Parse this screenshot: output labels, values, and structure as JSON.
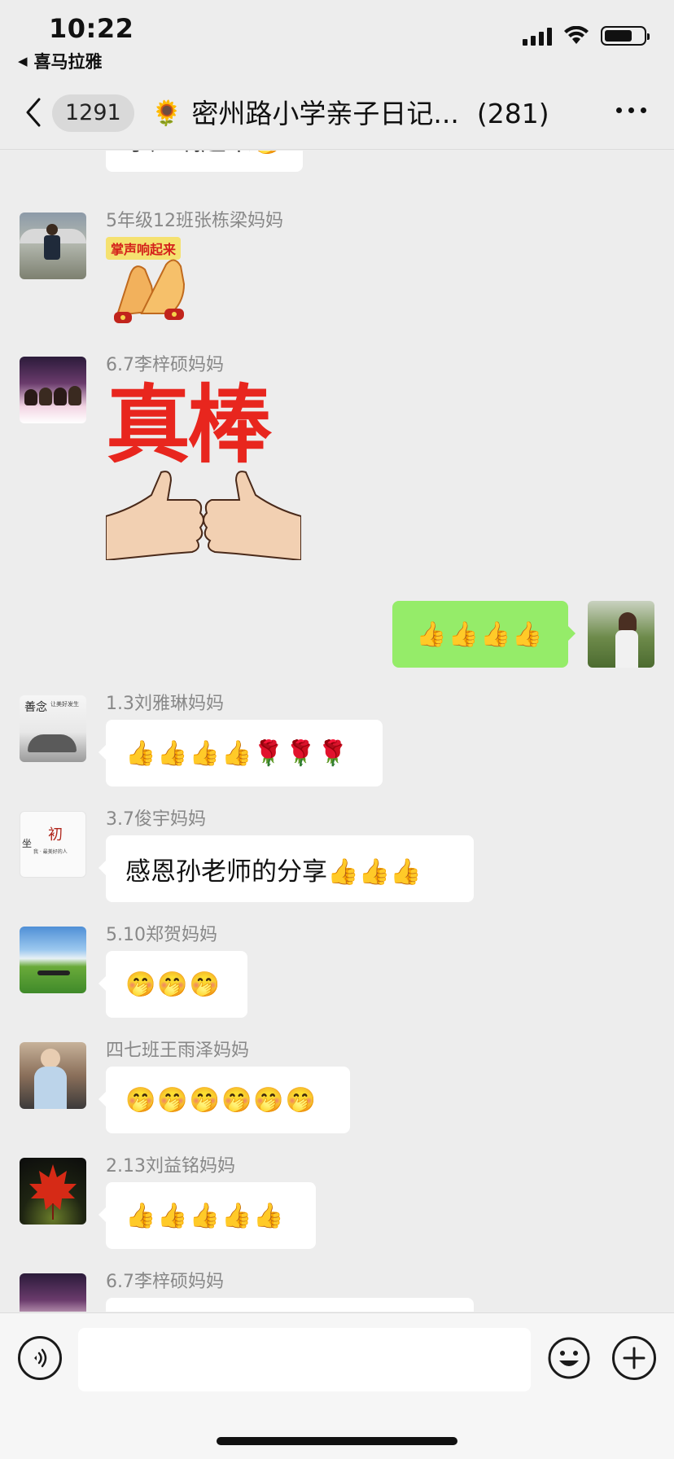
{
  "status": {
    "time": "10:22",
    "back_app": "喜马拉雅"
  },
  "nav": {
    "unread_count": "1291",
    "title_icon": "🌻",
    "title": "密州路小学亲子日记...",
    "member_count": "(281)"
  },
  "messages": [
    {
      "sender": "",
      "content": "掌声响起来🤭",
      "kind": "text"
    },
    {
      "sender": "5年级12班张栋梁妈妈",
      "content": "掌声响起来",
      "kind": "sticker-clap"
    },
    {
      "sender": "6.7李梓硕妈妈",
      "content": "真棒",
      "kind": "sticker-thumbs"
    },
    {
      "sender": "",
      "content": "👍👍👍👍",
      "kind": "sent"
    },
    {
      "sender": "1.3刘雅琳妈妈",
      "content": "👍👍👍👍🌹🌹🌹",
      "kind": "text"
    },
    {
      "sender": "3.7俊宇妈妈",
      "content": "感恩孙老师的分享👍👍👍",
      "kind": "text"
    },
    {
      "sender": "5.10郑贺妈妈",
      "content": "🤭🤭🤭",
      "kind": "text"
    },
    {
      "sender": "四七班王雨泽妈妈",
      "content": "🤭🤭🤭🤭🤭🤭",
      "kind": "text"
    },
    {
      "sender": "2.13刘益铭妈妈",
      "content": "👍👍👍👍👍",
      "kind": "text"
    },
    {
      "sender": "6.7李梓硕妈妈",
      "content": "",
      "kind": "text"
    }
  ],
  "avatar_text": {
    "m4": {
      "main": "善念",
      "sub": "让美好发生"
    },
    "m5": {
      "main": "初",
      "left": "坐",
      "sub": "我 · 最美好的人"
    }
  },
  "input": {
    "placeholder": ""
  },
  "colors": {
    "background": "#ededed",
    "sent_bubble": "#95ec69",
    "received_bubble": "#ffffff",
    "sticker_red": "#e8261e"
  },
  "icons": [
    "back-chevron-icon",
    "more-icon",
    "voice-icon",
    "emoji-icon",
    "plus-icon",
    "signal-icon",
    "wifi-icon",
    "battery-icon"
  ]
}
